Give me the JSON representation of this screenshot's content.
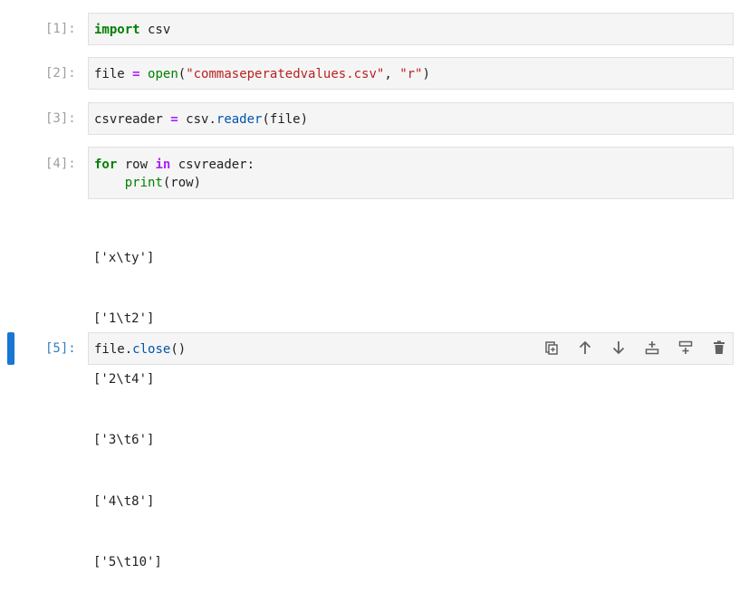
{
  "cells": [
    {
      "prompt": "[1]:"
    },
    {
      "prompt": "[2]:"
    },
    {
      "prompt": "[3]:"
    },
    {
      "prompt": "[4]:"
    },
    {
      "prompt": "[5]:"
    }
  ],
  "code": {
    "c1": {
      "kw_import": "import",
      "rest": " csv"
    },
    "c2": {
      "a": "file ",
      "eq": "=",
      "b": " ",
      "open": "open",
      "c": "(",
      "s1": "\"commaseperatedvalues.csv\"",
      "d": ", ",
      "s2": "\"r\"",
      "e": ")"
    },
    "c3": {
      "a": "csvreader ",
      "eq": "=",
      "b": " csv.",
      "reader": "reader",
      "c": "(file)"
    },
    "c4": {
      "kw_for": "for",
      "a": " row ",
      "kw_in": "in",
      "b": " csvreader:",
      "indent": "    ",
      "print": "print",
      "c": "(row)"
    },
    "c5": {
      "a": "file.",
      "close": "close",
      "b": "()"
    }
  },
  "output_lines": [
    "['x\\ty']",
    "['1\\t2']",
    "['2\\t4']",
    "['3\\t6']",
    "['4\\t8']",
    "['5\\t10']"
  ],
  "toolbar": {
    "icons": [
      "duplicate-icon",
      "move-up-icon",
      "move-down-icon",
      "insert-above-icon",
      "insert-below-icon",
      "delete-icon"
    ]
  },
  "colors": {
    "accent": "#1976d2",
    "keyword": "#008000",
    "string": "#ba2121",
    "operator": "#aa22ff",
    "attribute": "#0055aa"
  }
}
